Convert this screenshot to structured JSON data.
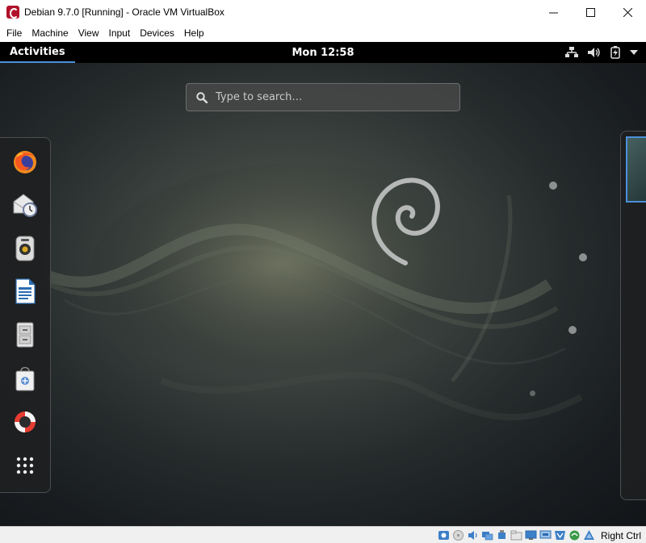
{
  "window": {
    "title": "Debian 9.7.0 [Running] - Oracle VM VirtualBox",
    "minimize_glyph": "—",
    "maximize_glyph": "☐",
    "close_glyph": "✕"
  },
  "menubar": {
    "items": [
      "File",
      "Machine",
      "View",
      "Input",
      "Devices",
      "Help"
    ]
  },
  "gnome": {
    "activities_label": "Activities",
    "clock": "Mon 12:58",
    "tray_icons": [
      "network-wired-icon",
      "volume-icon",
      "battery-icon",
      "system-menu-arrow-icon"
    ],
    "search_placeholder": "Type to search…",
    "accent_color": "#4a90d9",
    "dash_apps": [
      "firefox-icon",
      "evolution-mail-icon",
      "rhythmbox-icon",
      "libreoffice-writer-icon",
      "files-icon",
      "software-center-icon",
      "help-icon",
      "show-applications-icon"
    ]
  },
  "statusbar": {
    "icons": [
      "hard-disk-icon",
      "optical-drive-icon",
      "audio-icon",
      "network-icon",
      "usb-icon",
      "shared-folders-icon",
      "display-icon",
      "video-capture-icon",
      "cpu-icon",
      "mouse-integration-icon",
      "keyboard-icon"
    ],
    "host_key_label": "Right Ctrl"
  }
}
